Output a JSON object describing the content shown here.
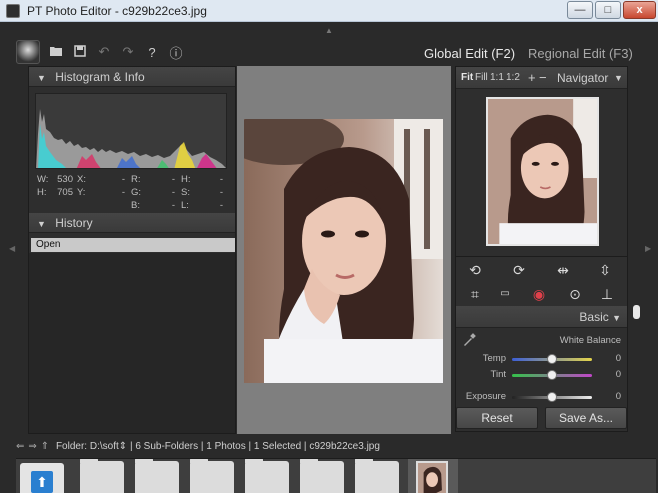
{
  "window": {
    "title": "PT Photo Editor - c929b22ce3.jpg",
    "min_label": "—",
    "max_label": "□",
    "close_label": "x"
  },
  "toolbar": {
    "icons": [
      "user-avatar",
      "open-folder-icon",
      "save-icon",
      "undo-icon",
      "redo-icon",
      "help-icon",
      "info-icon"
    ],
    "help_label": "?",
    "info_label": "ⓘ"
  },
  "modes": {
    "global": "Global Edit (F2)",
    "regional": "Regional Edit (F3)"
  },
  "histogram_panel": {
    "title": "Histogram & Info",
    "rows": [
      [
        {
          "k": "W:",
          "v": "530"
        },
        {
          "k": "X:",
          "v": "-"
        },
        {
          "k": "R:",
          "v": "-"
        },
        {
          "k": "H:",
          "v": "-"
        }
      ],
      [
        {
          "k": "H:",
          "v": "705"
        },
        {
          "k": "Y:",
          "v": "-"
        },
        {
          "k": "G:",
          "v": "-"
        },
        {
          "k": "S:",
          "v": "-"
        }
      ],
      [
        {
          "k": "",
          "v": ""
        },
        {
          "k": "",
          "v": ""
        },
        {
          "k": "B:",
          "v": "-"
        },
        {
          "k": "L:",
          "v": "-"
        }
      ]
    ]
  },
  "history_panel": {
    "title": "History",
    "items": [
      "Open"
    ]
  },
  "navigator": {
    "zoom_options": [
      "Fit",
      "Fill",
      "1:1",
      "1:2",
      "+",
      "−"
    ],
    "title": "Navigator"
  },
  "basic_panel": {
    "title": "Basic",
    "white_balance_label": "White Balance",
    "sliders": [
      {
        "label": "Temp",
        "value": "0",
        "fraction": 0.5,
        "track": "linear-gradient(90deg,#3d5fd6,#e3d44a)"
      },
      {
        "label": "Tint",
        "value": "0",
        "fraction": 0.5,
        "track": "linear-gradient(90deg,#34c24a,#c046c8)"
      },
      {
        "label": "Exposure",
        "value": "0",
        "fraction": 0.5,
        "track": "linear-gradient(90deg,#222,#eee)"
      }
    ]
  },
  "buttons": {
    "reset": "Reset",
    "save_as": "Save As..."
  },
  "filebar": {
    "folder_label": "Folder:",
    "folder_path": "D:\\soft",
    "summary": "| 6 Sub-Folders | 1 Photos | 1 Selected | c929b22ce3.jpg"
  },
  "colors": {
    "accent_blue": "#2a7fd0",
    "panel_bg": "#2e2e2e",
    "canvas_bg": "#7f7f7f"
  }
}
